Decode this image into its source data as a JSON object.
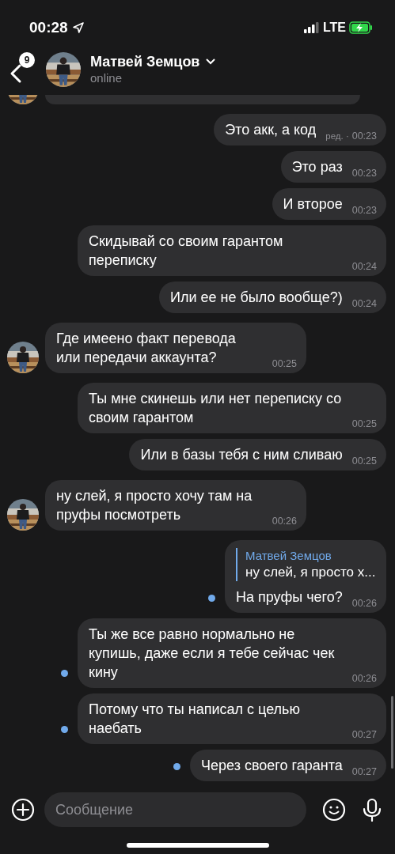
{
  "status_bar": {
    "time": "00:28",
    "network": "LTE"
  },
  "header": {
    "back_badge": "9",
    "contact_name": "Матвей Земцов",
    "status": "online"
  },
  "messages": [
    {
      "kind": "cut"
    },
    {
      "kind": "out",
      "text": "Это акк, а код",
      "edited_label": "ред. ·",
      "time": "00:23",
      "unread": false
    },
    {
      "kind": "out",
      "text": "Это раз",
      "time": "00:23",
      "unread": false
    },
    {
      "kind": "out",
      "text": "И второе",
      "time": "00:23",
      "unread": false
    },
    {
      "kind": "out",
      "text": "Скидывай со своим гарантом переписку",
      "time": "00:24",
      "unread": false
    },
    {
      "kind": "out",
      "text": "Или ее не было вообще?)",
      "time": "00:24",
      "unread": false
    },
    {
      "kind": "in",
      "text": "Где имеено факт перевода или передачи аккаунта?",
      "time": "00:25"
    },
    {
      "kind": "out",
      "text": "Ты мне скинешь или нет переписку со своим гарантом",
      "time": "00:25",
      "unread": false
    },
    {
      "kind": "out",
      "text": "Или в базы тебя с ним сливаю",
      "time": "00:25",
      "unread": false
    },
    {
      "kind": "in",
      "text": "ну слей, я просто хочу там на пруфы посмотреть",
      "time": "00:26"
    },
    {
      "kind": "out",
      "reply": {
        "author": "Матвей Земцов",
        "text": "ну слей, я просто х..."
      },
      "text": "На пруфы чего?",
      "time": "00:26",
      "unread": true
    },
    {
      "kind": "out",
      "text": "Ты же все равно нормально не купишь, даже если я тебе сейчас чек кину",
      "time": "00:26",
      "unread": true
    },
    {
      "kind": "out",
      "text": "Потому что ты написал с целью наебать",
      "time": "00:27",
      "unread": true
    },
    {
      "kind": "out",
      "text": "Через своего гаранта",
      "time": "00:27",
      "unread": true
    }
  ],
  "composer": {
    "placeholder": "Сообщение"
  }
}
